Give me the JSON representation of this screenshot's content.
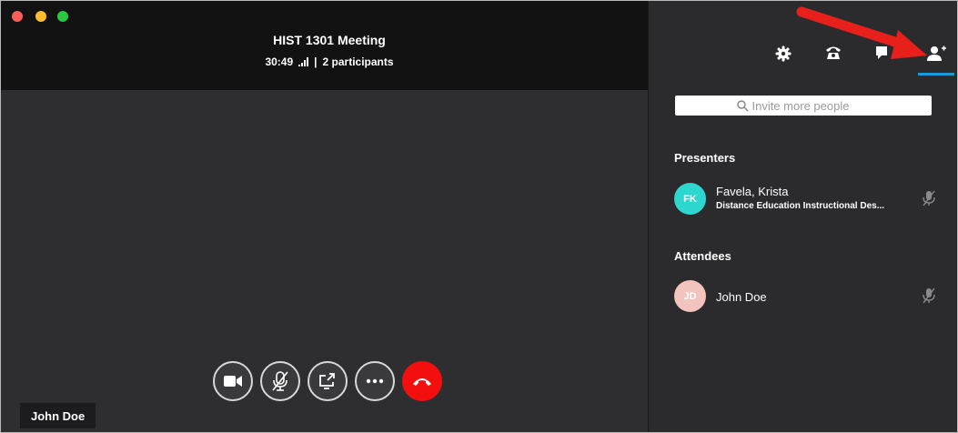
{
  "meeting": {
    "title": "HIST 1301 Meeting",
    "elapsed": "30:49",
    "separator": "|",
    "participants": "2 participants"
  },
  "controls": [
    "video-camera-icon",
    "microphone-muted-icon",
    "share-screen-icon",
    "more-icon",
    "end-call-icon"
  ],
  "self_name_tag": "John Doe",
  "panel": {
    "tabs": [
      "gear-icon",
      "phone-icon",
      "chat-icon",
      "add-person-icon"
    ],
    "active_tab": "add-person-icon",
    "search_placeholder": "Invite more people",
    "presenters_heading": "Presenters",
    "presenters": [
      {
        "initials": "FK",
        "name": "Favela, Krista",
        "title": "Distance Education Instructional Des...",
        "avatar_color": "#2ed6d0"
      }
    ],
    "attendees_heading": "Attendees",
    "attendees": [
      {
        "initials": "JD",
        "name": "John Doe",
        "avatar_color": "#f2c4bd"
      }
    ]
  },
  "colors": {
    "end_call": "#f40f0f",
    "active_tab_underline": "#1a9bd7",
    "annotation_arrow": "#e8201b"
  }
}
